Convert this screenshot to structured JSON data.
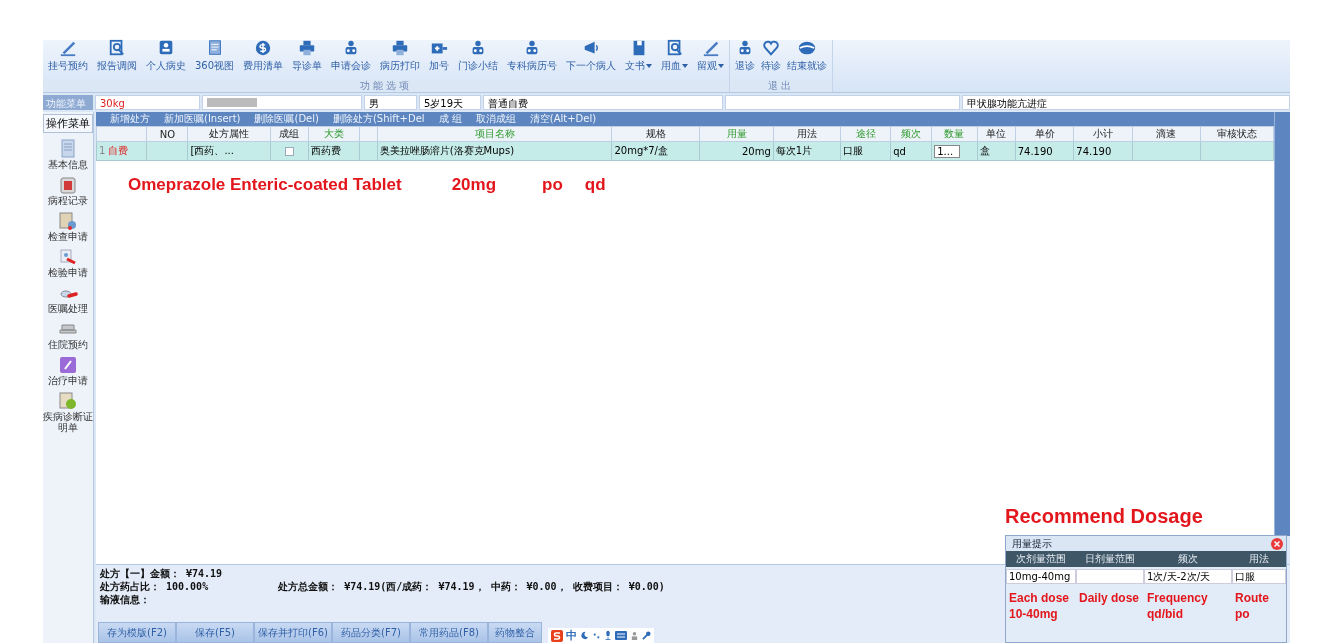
{
  "toolbar": {
    "groups": [
      {
        "label": "功能选项",
        "items": [
          {
            "label": "挂号预约",
            "kind": "button"
          },
          {
            "label": "报告调阅",
            "kind": "button"
          },
          {
            "label": "个人病史",
            "kind": "button"
          },
          {
            "label": "360视图",
            "kind": "button"
          },
          {
            "label": "费用清单",
            "kind": "button"
          },
          {
            "label": "导诊单",
            "kind": "button"
          },
          {
            "label": "申请会诊",
            "kind": "button"
          },
          {
            "label": "病历打印",
            "kind": "button"
          },
          {
            "label": "加号",
            "kind": "button"
          },
          {
            "label": "门诊小结",
            "kind": "button"
          },
          {
            "label": "专科病历号",
            "kind": "button"
          },
          {
            "label": "下一个病人",
            "kind": "button"
          },
          {
            "label": "文书",
            "kind": "dropdown"
          },
          {
            "label": "用血",
            "kind": "dropdown"
          },
          {
            "label": "留观",
            "kind": "dropdown"
          }
        ]
      },
      {
        "label": "退出",
        "items": [
          {
            "label": "退诊",
            "kind": "button"
          },
          {
            "label": "待诊",
            "kind": "button"
          },
          {
            "label": "结束就诊",
            "kind": "button"
          }
        ]
      }
    ]
  },
  "patient_bar": {
    "menu_tab": "功能菜单",
    "weight": "30kg",
    "sex": "男",
    "age": "5岁19天",
    "payment": "普通自费",
    "diagnosis": "甲状腺功能亢进症"
  },
  "side_menu": {
    "title": "操作菜单",
    "items": [
      "基本信息",
      "病程记录",
      "检查申请",
      "检验申请",
      "医嘱处理",
      "住院预约",
      "治疗申请",
      "疾病诊断证明单"
    ]
  },
  "actions": [
    "新增处方",
    "新加医嘱(Insert)",
    "删除医嘱(Del)",
    "删除处方(Shift+Del",
    "成 组",
    "取消成组",
    "清空(Alt+Del)"
  ],
  "table": {
    "columns": [
      {
        "label": "NO",
        "accent": false
      },
      {
        "label": "处方属性",
        "accent": false
      },
      {
        "label": "成组",
        "accent": false
      },
      {
        "label": "大类",
        "accent": true
      },
      {
        "label": "项目名称",
        "accent": true
      },
      {
        "label": "规格",
        "accent": false
      },
      {
        "label": "用量",
        "accent": true
      },
      {
        "label": "用法",
        "accent": false
      },
      {
        "label": "途径",
        "accent": true
      },
      {
        "label": "频次",
        "accent": true
      },
      {
        "label": "数量",
        "accent": true
      },
      {
        "label": "单位",
        "accent": false
      },
      {
        "label": "单价",
        "accent": false
      },
      {
        "label": "小计",
        "accent": false
      },
      {
        "label": "滴速",
        "accent": false
      },
      {
        "label": "审核状态",
        "accent": false
      }
    ],
    "rows": [
      {
        "selected": true,
        "index": "1",
        "payment": "自费",
        "attribute": "[西药、...",
        "grouped": false,
        "category": "西药费",
        "name": "奥美拉唑肠溶片(洛赛克Mups)",
        "spec": "20mg*7/盒",
        "dose": "20mg",
        "usage": "每次1片",
        "route": "口服",
        "frequency": "qd",
        "quantity": "1...",
        "unit": "盒",
        "price": "74.190",
        "subtotal": "74.190"
      }
    ]
  },
  "annotations": [
    "Omeprazole Enteric-coated Tablet",
    "20mg",
    "po",
    "qd"
  ],
  "summary": {
    "amount": "处方【一】金额： ¥74.19",
    "ratio": "处方药占比： 100.00%",
    "total": "处方总金额： ¥74.19(西/成药： ¥74.19， 中药： ¥0.00， 收费项目： ¥0.00)",
    "infusion": "输液信息："
  },
  "bottom_tabs": [
    "存为模版(F2)",
    "保存(F5)",
    "保存并打印(F6)",
    "药品分类(F7)",
    "常用药品(F8)",
    "药物整合"
  ],
  "ime": {
    "mode": "中"
  },
  "dose_popup": {
    "caption": "Recommend Dosage",
    "title": "用量提示",
    "columns": [
      {
        "header": "次剂量范围",
        "value": "10mg-40mg",
        "note": "Each dose",
        "note_value": "10-40mg"
      },
      {
        "header": "日剂量范围",
        "note": "Daily dose"
      },
      {
        "header": "频次",
        "value": "1次/天-2次/天",
        "note": "Frequency",
        "note_value": "qd/bid"
      },
      {
        "header": "用法",
        "value": "口服",
        "note": "Route",
        "note_value": "po"
      }
    ]
  }
}
